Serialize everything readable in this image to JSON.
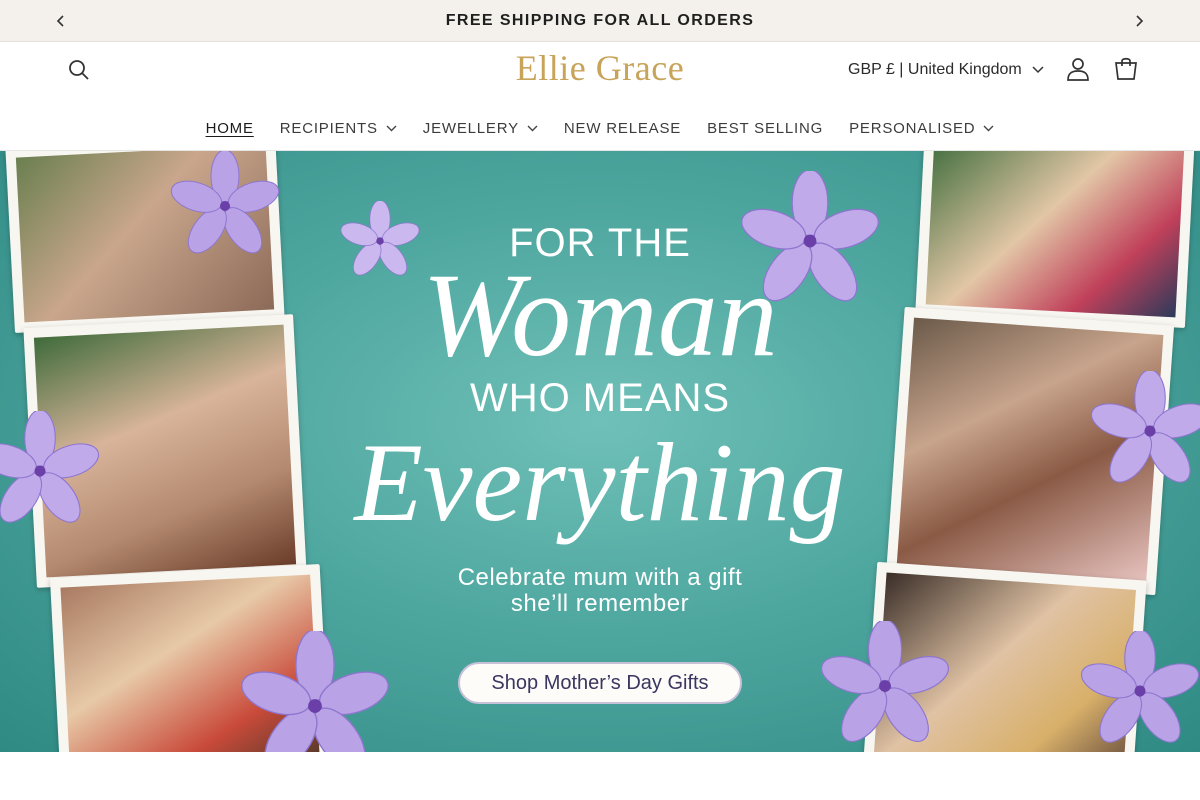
{
  "announcement": {
    "text": "FREE SHIPPING FOR ALL ORDERS",
    "prev_icon": "chevron-left-icon",
    "next_icon": "chevron-right-icon"
  },
  "header": {
    "logo": "Ellie Grace",
    "country_selector": "GBP £ | United Kingdom",
    "icons": [
      "search-icon",
      "account-icon",
      "cart-icon"
    ]
  },
  "nav": {
    "items": [
      {
        "label": "HOME",
        "dropdown": false,
        "active": true
      },
      {
        "label": "RECIPIENTS",
        "dropdown": true
      },
      {
        "label": "JEWELLERY",
        "dropdown": true
      },
      {
        "label": "NEW RELEASE",
        "dropdown": false
      },
      {
        "label": "BEST SELLING",
        "dropdown": false
      },
      {
        "label": "PERSONALISED",
        "dropdown": true
      }
    ]
  },
  "hero": {
    "line1": "FOR THE",
    "line2": "Woman",
    "line3": "WHO MEANS",
    "line4": "Everything",
    "subtitle_1": "Celebrate mum with a gift",
    "subtitle_2": "she’ll remember",
    "cta": "Shop Mother’s Day Gifts"
  },
  "colors": {
    "accent_gold": "#c8a35a",
    "hero_teal": "#4ea79f",
    "announce_bg": "#f4f1ec",
    "flower": "#b9a3e6"
  }
}
